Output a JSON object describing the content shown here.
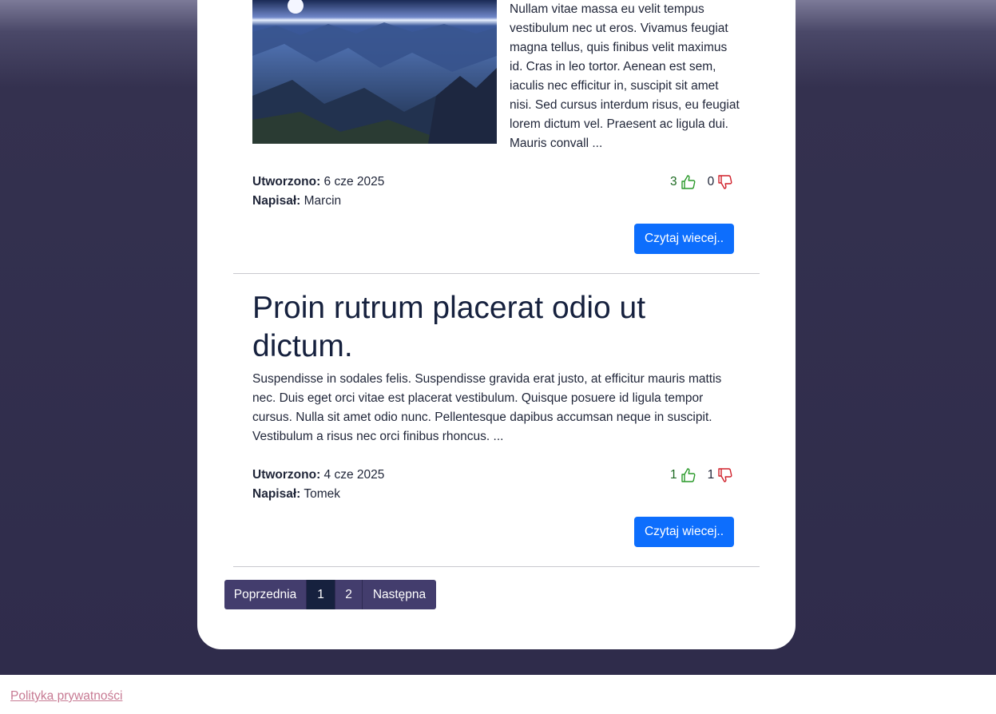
{
  "posts": [
    {
      "excerpt": "Nullam vitae massa eu velit tempus vestibulum nec ut eros. Vivamus feugiat magna tellus, quis finibus velit maximus id. Cras in leo tortor. Aenean est sem, iaculis nec efficitur in, suscipit sit amet nisi. Sed cursus interdum risus, eu feugiat lorem dictum vel. Praesent ac ligula dui. Mauris convall ...",
      "created_label": "Utworzono:",
      "created_value": "6 cze 2025",
      "author_label": "Napisał:",
      "author_value": "Marcin",
      "likes": "3",
      "dislikes": "0",
      "read_more": "Czytaj wiecej.."
    },
    {
      "title": "Proin rutrum placerat odio ut dictum.",
      "excerpt": "Suspendisse in sodales felis. Suspendisse gravida erat justo, at efficitur mauris mattis nec. Duis eget orci vitae est placerat vestibulum. Quisque posuere id ligula tempor cursus. Nulla sit amet odio nunc. Pellentesque dapibus accumsan neque in suscipit. Vestibulum a risus nec orci finibus rhoncus. ...",
      "created_label": "Utworzono:",
      "created_value": "4 cze 2025",
      "author_label": "Napisał:",
      "author_value": "Tomek",
      "likes": "1",
      "dislikes": "1",
      "read_more": "Czytaj wiecej.."
    }
  ],
  "pagination": {
    "prev": "Poprzednia",
    "pages": [
      "1",
      "2"
    ],
    "current": "1",
    "next": "Następna"
  },
  "footer": {
    "privacy_link": "Polityka prywatności"
  },
  "colors": {
    "accent_button": "#0d6efd",
    "pager_bg": "#433d6d",
    "pager_active": "#16213e",
    "like_icon": "#2a9a2a",
    "dislike_icon": "#d0202a",
    "footer_link": "#c77a93"
  },
  "icons": {
    "like": "thumbs-up-icon",
    "dislike": "thumbs-down-icon"
  }
}
